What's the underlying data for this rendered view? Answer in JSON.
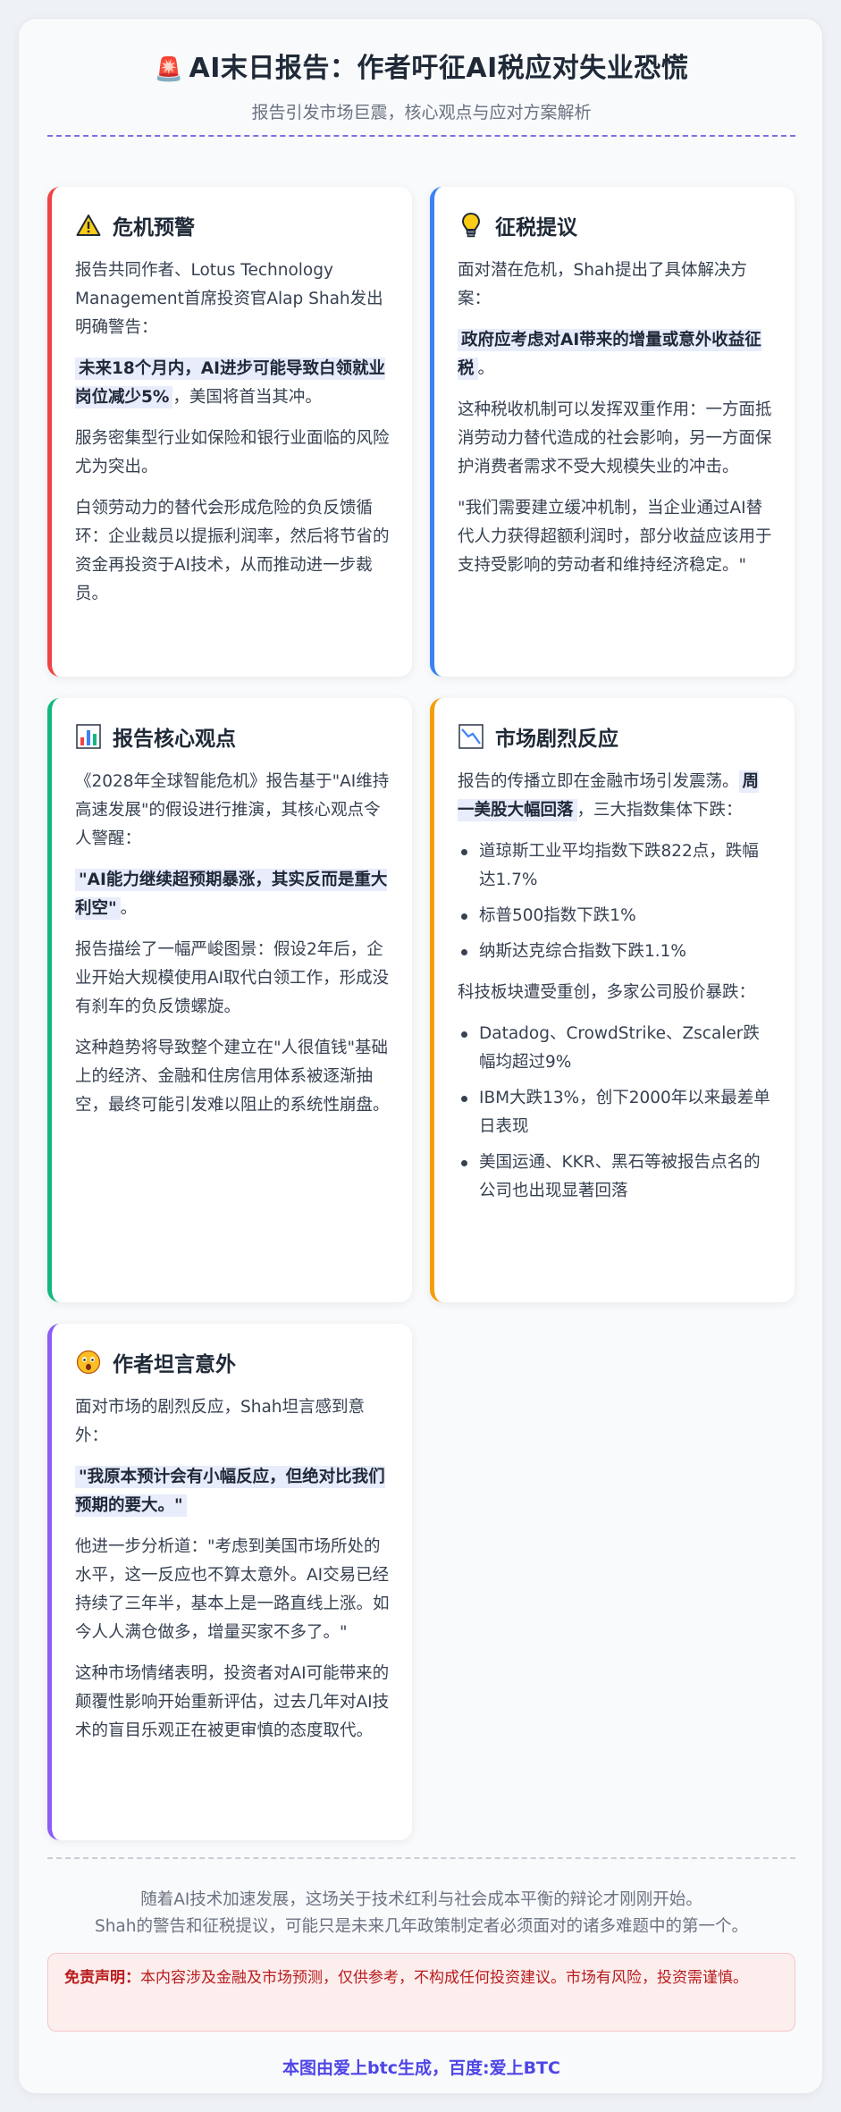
{
  "header": {
    "icon": "siren-icon",
    "title": "AI末日报告：作者吁征AI税应对失业恐慌",
    "subtitle": "报告引发市场巨震，核心观点与应对方案解析"
  },
  "cards": {
    "crisis": {
      "icon": "warning-icon",
      "title": "危机预警",
      "p1": "报告共同作者、Lotus Technology Management首席投资官Alap Shah发出明确警告：",
      "p2_highlight": "未来18个月内，AI进步可能导致白领就业岗位减少5%",
      "p2_rest": "，美国将首当其冲。",
      "p3": "服务密集型行业如保险和银行业面临的风险尤为突出。",
      "p4": "白领劳动力的替代会形成危险的负反馈循环：企业裁员以提振利润率，然后将节省的资金再投资于AI技术，从而推动进一步裁员。"
    },
    "tax": {
      "icon": "lightbulb-icon",
      "title": "征税提议",
      "p1": "面对潜在危机，Shah提出了具体解决方案：",
      "p2_highlight": "政府应考虑对AI带来的增量或意外收益征税",
      "p2_rest": "。",
      "p3": "这种税收机制可以发挥双重作用：一方面抵消劳动力替代造成的社会影响，另一方面保护消费者需求不受大规模失业的冲击。",
      "p4": "\"我们需要建立缓冲机制，当企业通过AI替代人力获得超额利润时，部分收益应该用于支持受影响的劳动者和维持经济稳定。\""
    },
    "core": {
      "icon": "bar-chart-icon",
      "title": "报告核心观点",
      "p1": "《2028年全球智能危机》报告基于\"AI维持高速发展\"的假设进行推演，其核心观点令人警醒：",
      "p2_highlight": "\"AI能力继续超预期暴涨，其实反而是重大利空\"",
      "p2_rest": "。",
      "p3": "报告描绘了一幅严峻图景：假设2年后，企业开始大规模使用AI取代白领工作，形成没有刹车的负反馈螺旋。",
      "p4": "这种趋势将导致整个建立在\"人很值钱\"基础上的经济、金融和住房信用体系被逐渐抽空，最终可能引发难以阻止的系统性崩盘。"
    },
    "market": {
      "icon": "chart-decreasing-icon",
      "title": "市场剧烈反应",
      "p1_pre": "报告的传播立即在金融市场引发震荡。",
      "p1_highlight": "周一美股大幅回落",
      "p1_rest": "，三大指数集体下跌：",
      "list1": [
        "道琼斯工业平均指数下跌822点，跌幅达1.7%",
        "标普500指数下跌1%",
        "纳斯达克综合指数下跌1.1%"
      ],
      "p2": "科技板块遭受重创，多家公司股价暴跌：",
      "list2": [
        "Datadog、CrowdStrike、Zscaler跌幅均超过9%",
        "IBM大跌13%，创下2000年以来最差单日表现",
        "美国运通、KKR、黑石等被报告点名的公司也出现显著回落"
      ]
    },
    "author": {
      "icon": "astonished-face-icon",
      "title": "作者坦言意外",
      "p1": "面对市场的剧烈反应，Shah坦言感到意外：",
      "p2_highlight": "\"我原本预计会有小幅反应，但绝对比我们预期的要大。\"",
      "p3": "他进一步分析道：\"考虑到美国市场所处的水平，这一反应也不算太意外。AI交易已经持续了三年半，基本上是一路直线上涨。如今人人满仓做多，增量买家不多了。\"",
      "p4": "这种市场情绪表明，投资者对AI可能带来的颠覆性影响开始重新评估，过去几年对AI技术的盲目乐观正在被更审慎的态度取代。"
    }
  },
  "footer": {
    "line1": "随着AI技术加速发展，这场关于技术红利与社会成本平衡的辩论才刚刚开始。",
    "line2": "Shah的警告和征税提议，可能只是未来几年政策制定者必须面对的诸多难题中的第一个。",
    "disclaimer_label": "免责声明：",
    "disclaimer_text": "本内容涉及金融及市场预测，仅供参考，不构成任何投资建议。市场有风险，投资需谨慎。",
    "credit": "本图由爱上btc生成，百度:爱上BTC"
  }
}
